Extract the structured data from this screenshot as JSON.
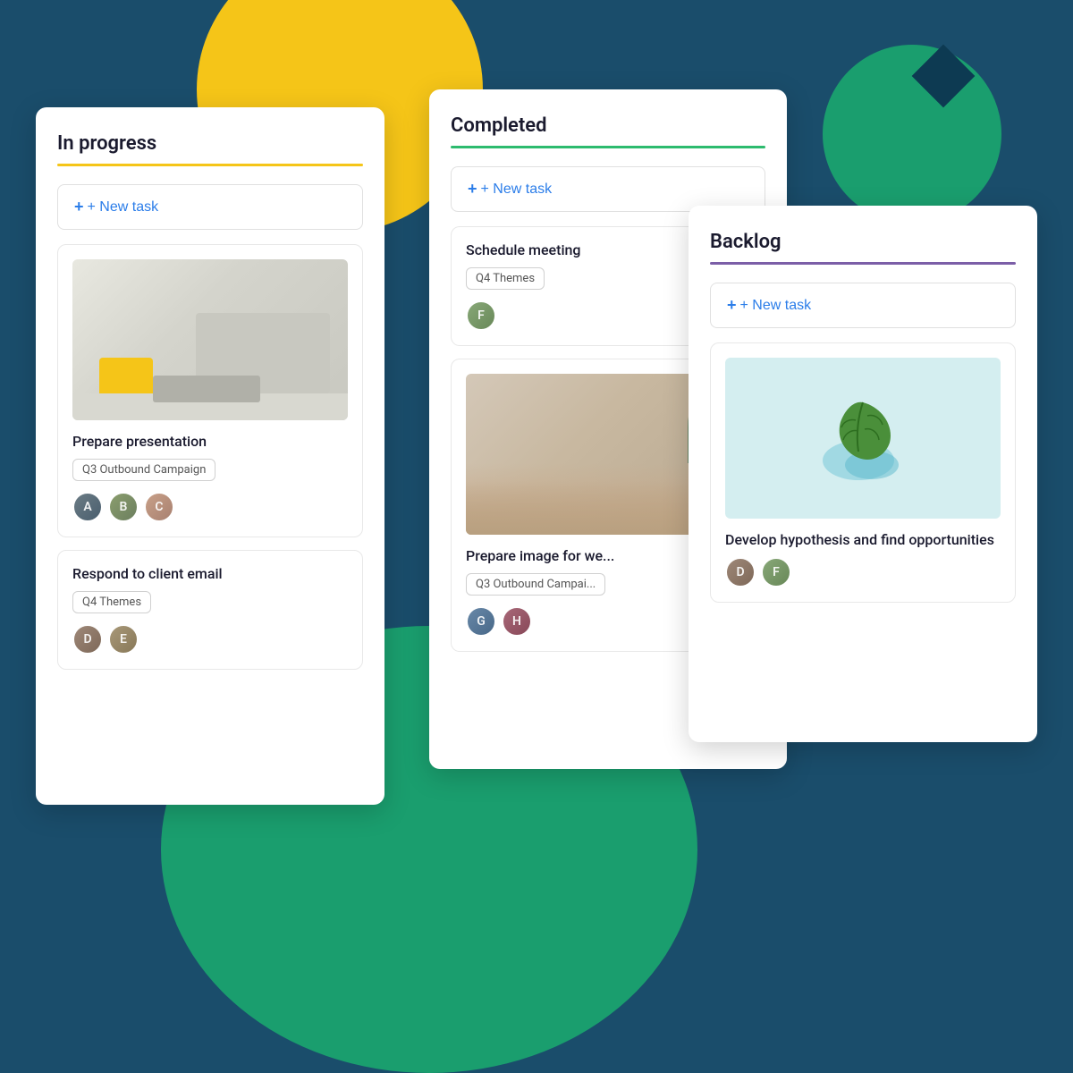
{
  "background": {
    "color": "#1a4d6b"
  },
  "columns": {
    "in_progress": {
      "title": "In progress",
      "underline_color": "#f5c518",
      "new_task_label": "+ New task",
      "tasks": [
        {
          "id": "task-1",
          "name": "Prepare presentation",
          "tag": "Q3 Outbound Campaign",
          "has_image": true,
          "image_type": "workspace",
          "avatars": [
            "av1",
            "av2",
            "av3"
          ]
        },
        {
          "id": "task-2",
          "name": "Respond to client email",
          "tag": "Q4 Themes",
          "has_image": false,
          "avatars": [
            "av4",
            "av5"
          ]
        }
      ]
    },
    "completed": {
      "title": "Completed",
      "underline_color": "#2dbb6e",
      "new_task_label": "+ New task",
      "tasks": [
        {
          "id": "task-3",
          "name": "Schedule meeting",
          "tag": "Q4 Themes",
          "has_image": false,
          "avatars": [
            "av6"
          ]
        },
        {
          "id": "task-4",
          "name": "Prepare image for we...",
          "tag": "Q3 Outbound Campai...",
          "has_image": true,
          "image_type": "bedroom",
          "avatars": [
            "av7",
            "av8"
          ]
        }
      ]
    },
    "backlog": {
      "title": "Backlog",
      "underline_color": "#7b5ea7",
      "new_task_label": "+ New task",
      "tasks": [
        {
          "id": "task-5",
          "name": "Develop hypothesis and find opportunities",
          "tag": null,
          "has_image": true,
          "image_type": "leaf",
          "avatars": [
            "av4",
            "av6"
          ]
        }
      ]
    }
  }
}
